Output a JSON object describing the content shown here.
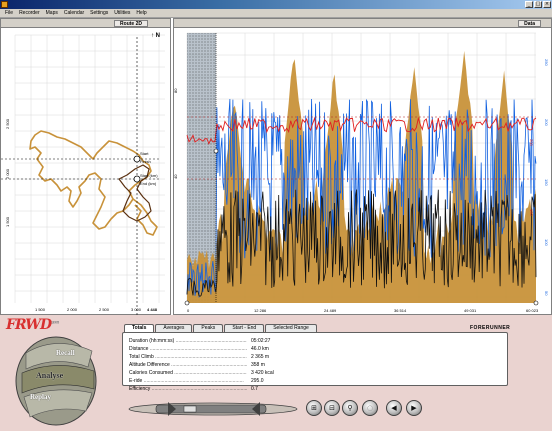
{
  "window": {
    "min_glyph": "_",
    "max_glyph": "□",
    "close_glyph": "×"
  },
  "menu": [
    "File",
    "Recorder",
    "Maps",
    "Calendar",
    "Settings",
    "Utilities",
    "Help"
  ],
  "route_panel": {
    "title": "Route 2D",
    "north_glyph": "↑ N",
    "y_ticks": [
      "2 500",
      "2 000",
      "1 500"
    ],
    "x_ticks": [
      "1 500",
      "2 000",
      "2 500",
      "3 000"
    ],
    "marker_label": "4 448",
    "point_labels": [
      "Start",
      "Finish",
      "Start (km)",
      "End (km)"
    ]
  },
  "graph_panel": {
    "title": "Data",
    "x_ticks": [
      "0",
      "12 286",
      "24 489",
      "36 514",
      "49 031",
      "60 023"
    ],
    "left_ticks": [
      "80",
      "40"
    ],
    "right_ticks": [
      "250",
      "200",
      "150",
      "100",
      "50"
    ],
    "colors": {
      "altitude": "#c8923a",
      "heart_rate": "#e02020",
      "speed": "#1060e0",
      "cadence": "#101010",
      "selection": "#506070"
    }
  },
  "bottom": {
    "logo": "FRWD",
    "logo_sup": "2008",
    "pod": {
      "upper": "Recall",
      "middle": "Analyse",
      "lower": "Replay"
    },
    "tabs": [
      "Totals",
      "Averages",
      "Peaks",
      "Start - End",
      "Selected Range"
    ],
    "active_tab": "Totals",
    "brand": "FORERUNNER",
    "stats": [
      {
        "label": "Duration (hh:mm:ss)",
        "value": "05:02:27"
      },
      {
        "label": "Distance",
        "value": "46.0 km"
      },
      {
        "label": "Total Climb",
        "value": "2 365 m"
      },
      {
        "label": "Altitude Difference",
        "value": "358 m"
      },
      {
        "label": "Calories Consumed",
        "value": "3 420 kcal"
      },
      {
        "label": "E-ride",
        "value": "295.0"
      },
      {
        "label": "Efficiency",
        "value": "0.7"
      }
    ],
    "round_buttons": [
      {
        "name": "zoom-in-button",
        "glyph": "⊞"
      },
      {
        "name": "zoom-range-button",
        "glyph": "⊟"
      },
      {
        "name": "search-button",
        "glyph": "⚲"
      },
      {
        "name": "disabled-button",
        "glyph": "○"
      },
      {
        "name": "prev-button",
        "glyph": "◀"
      },
      {
        "name": "next-button",
        "glyph": "▶"
      }
    ]
  }
}
